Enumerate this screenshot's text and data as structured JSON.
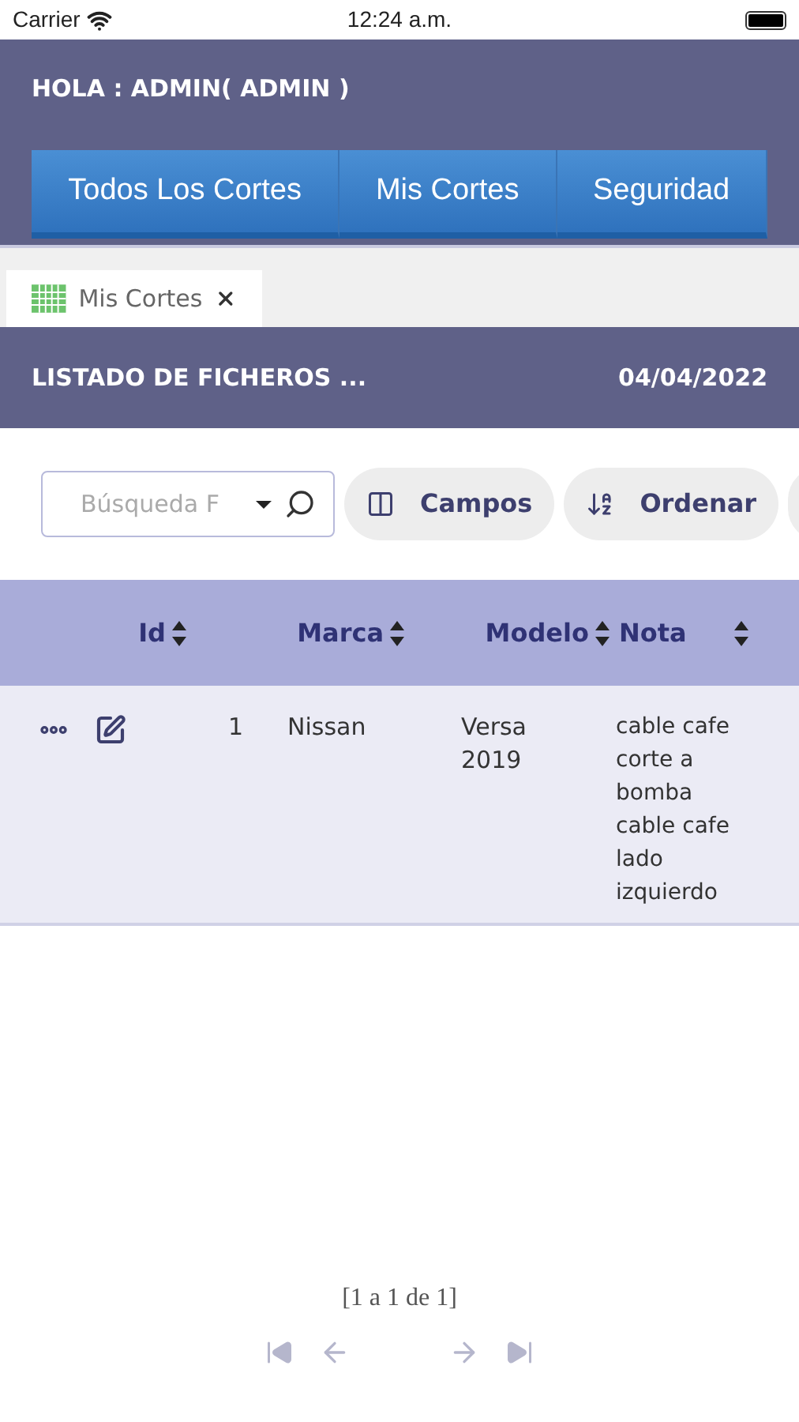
{
  "status_bar": {
    "carrier": "Carrier",
    "time": "12:24 a.m."
  },
  "header": {
    "greeting": "HOLA : ADMIN( ADMIN )"
  },
  "nav_tabs": [
    {
      "label": "Todos Los Cortes",
      "selected": false
    },
    {
      "label": "Mis Cortes",
      "selected": false
    },
    {
      "label": "Seguridad",
      "selected": false
    }
  ],
  "doc_tab": {
    "label": "Mis Cortes"
  },
  "title_bar": {
    "title": "LISTADO DE FICHEROS ...",
    "date": "04/04/2022"
  },
  "toolbar": {
    "search": {
      "placeholder": "Búsqueda F"
    },
    "buttons": [
      {
        "kind": "columns",
        "label": "Campos"
      },
      {
        "kind": "sort",
        "label": "Ordenar"
      }
    ]
  },
  "table": {
    "columns": [
      "Id",
      "Marca",
      "Modelo",
      "Nota"
    ],
    "rows": [
      {
        "cells": [
          "1",
          "Nissan",
          "Versa 2019",
          "cable cafe corte a bomba cable cafe lado izquierdo"
        ]
      }
    ]
  },
  "pager": {
    "summary": "[1 a 1 de 1]"
  }
}
